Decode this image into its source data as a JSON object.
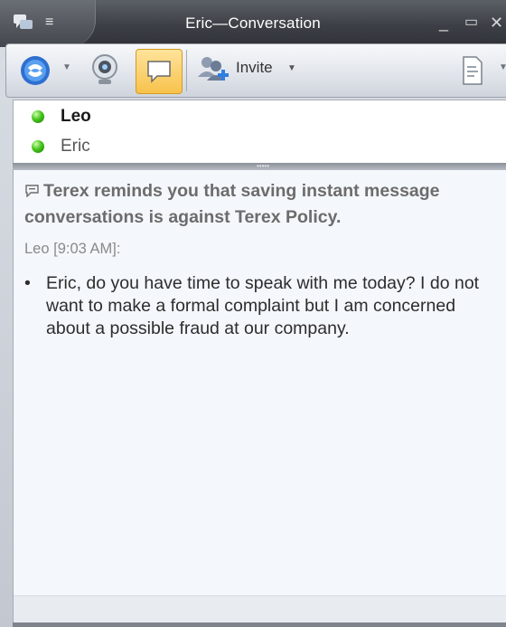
{
  "window": {
    "title": "Eric—Conversation",
    "menu_glyph": "≡",
    "minimize_glyph": "_",
    "maximize_glyph": "▭",
    "close_glyph": "✕"
  },
  "toolbar": {
    "invite_label": "Invite",
    "dropdown_glyph": "▼",
    "icons": [
      "phone-icon",
      "webcam-icon",
      "im-icon",
      "invite-contacts-icon",
      "share-document-icon"
    ],
    "active_color": "#f7c24c"
  },
  "participants": [
    {
      "name": "Leo",
      "status_color": "#46c51b"
    },
    {
      "name": "Eric",
      "status_color": "#46c51b"
    }
  ],
  "conversation": {
    "policy_notice": "Terex reminds you that saving instant message conversations is against Terex Policy.",
    "sender_line": "Leo [9:03 AM]:",
    "bullet": "•",
    "message": "Eric, do you have time to speak with me today? I do not want to make a formal complaint but I am concerned about a possible fraud at our company."
  }
}
